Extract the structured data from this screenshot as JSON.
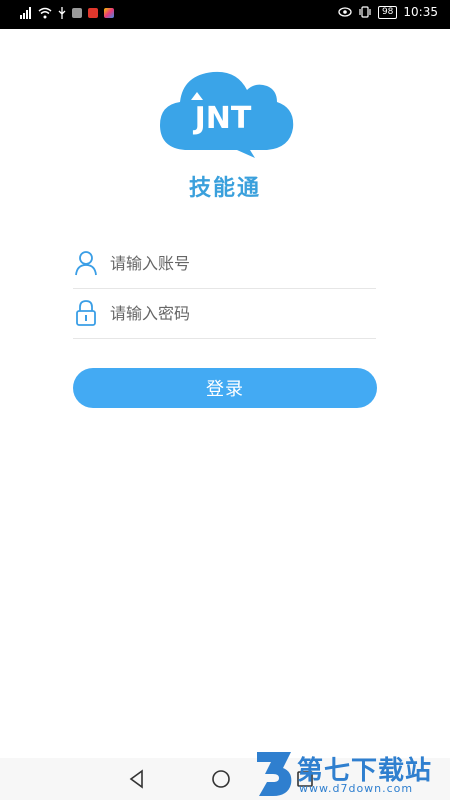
{
  "status_bar": {
    "battery": "98",
    "time": "10:35"
  },
  "logo": {
    "text": "JNT"
  },
  "app_name": "技能通",
  "login_form": {
    "account_placeholder": "请输入账号",
    "password_placeholder": "请输入密码",
    "login_label": "登录"
  },
  "watermark": {
    "title": "第七下载站",
    "url": "www.d7down.com"
  },
  "colors": {
    "brand_blue": "#43aaf3",
    "title_blue": "#3aa0dc"
  }
}
